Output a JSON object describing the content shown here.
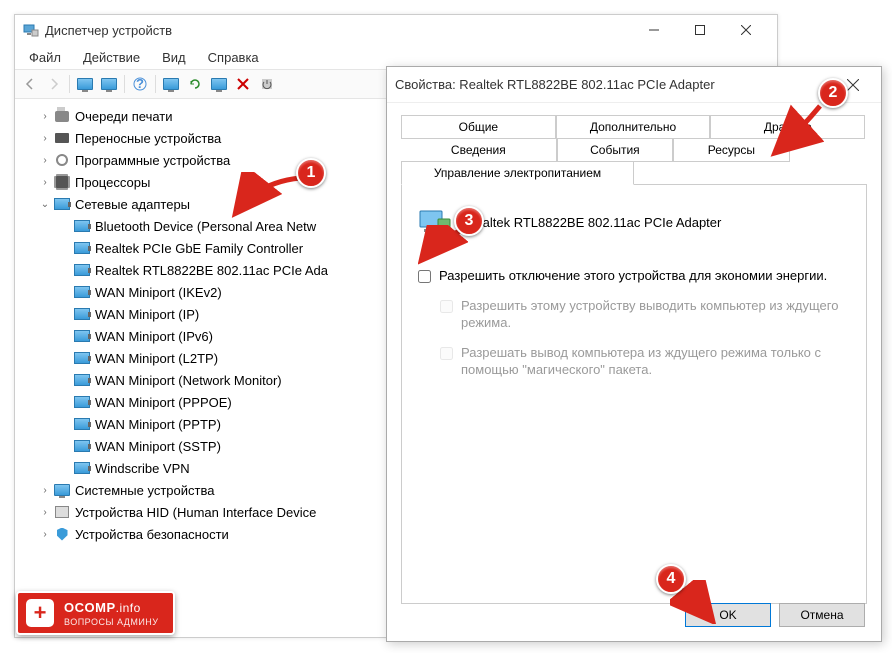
{
  "main_window": {
    "title": "Диспетчер устройств",
    "menu": {
      "file": "Файл",
      "action": "Действие",
      "view": "Вид",
      "help": "Справка"
    }
  },
  "tree": {
    "print_queues": "Очереди печати",
    "portable": "Переносные устройства",
    "software": "Программные устройства",
    "processors": "Процессоры",
    "network_adapters": "Сетевые адаптеры",
    "na": {
      "bt": "Bluetooth Device (Personal Area Netw",
      "gbe": "Realtek PCIe GbE Family Controller",
      "rtl": "Realtek RTL8822BE 802.11ac PCIe Ada",
      "ikev2": "WAN Miniport (IKEv2)",
      "ip": "WAN Miniport (IP)",
      "ipv6": "WAN Miniport (IPv6)",
      "l2tp": "WAN Miniport (L2TP)",
      "nm": "WAN Miniport (Network Monitor)",
      "pppoe": "WAN Miniport (PPPOE)",
      "pptp": "WAN Miniport (PPTP)",
      "sstp": "WAN Miniport (SSTP)",
      "ws": "Windscribe VPN"
    },
    "system": "Системные устройства",
    "hid": "Устройства HID (Human Interface Device",
    "security": "Устройства безопасности"
  },
  "dialog": {
    "title": "Свойства: Realtek RTL8822BE 802.11ac PCIe Adapter",
    "tabs": {
      "general": "Общие",
      "advanced": "Дополнительно",
      "driver": "Драйвер",
      "details": "Сведения",
      "events": "События",
      "resources": "Ресурсы",
      "power": "Управление электропитанием"
    },
    "device_name": "Realtek RTL8822BE 802.11ac PCIe Adapter",
    "cb1": "Разрешить отключение этого устройства для экономии энергии.",
    "cb2": "Разрешить этому устройству выводить компьютер из ждущего режима.",
    "cb3": "Разрешать вывод компьютера из ждущего режима только с помощью \"магического\" пакета.",
    "ok": "OK",
    "cancel": "Отмена"
  },
  "badges": {
    "b1": "1",
    "b2": "2",
    "b3": "3",
    "b4": "4"
  },
  "watermark": {
    "line1a": "OCOMP",
    "line1b": ".info",
    "line2": "ВОПРОСЫ АДМИНУ"
  }
}
